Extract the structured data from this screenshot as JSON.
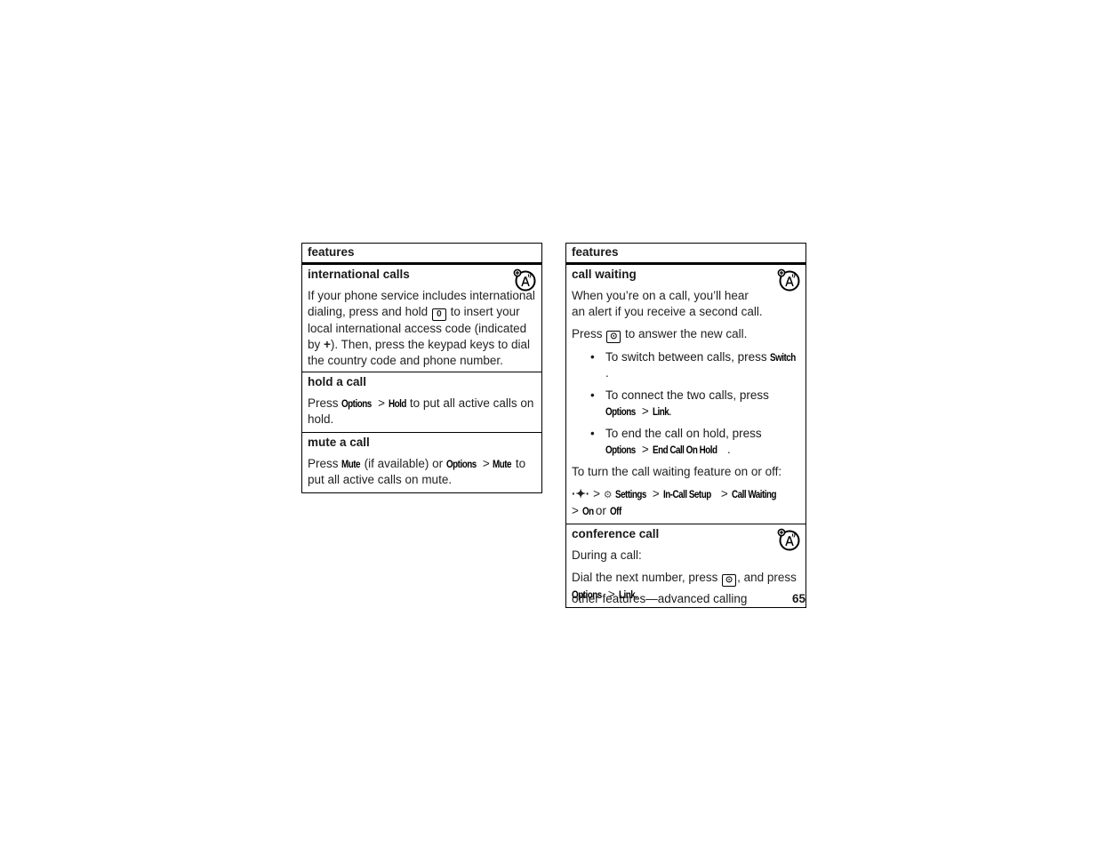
{
  "left_table": {
    "header": "features",
    "rows": [
      {
        "title": "international calls",
        "icon": "network-feature-icon",
        "text": [
          "If your phone service includes international dialing, press and hold ",
          "0",
          " to insert your local international access code (indicated by ",
          "+",
          "). Then, press the keypad keys to dial the country code and phone number."
        ]
      },
      {
        "title": "hold a call",
        "text": [
          "Press ",
          "Options",
          " > ",
          "Hold",
          " to put all active calls on hold."
        ]
      },
      {
        "title": "mute a call",
        "text": [
          "Press ",
          "Mute",
          " (if available) or ",
          "Options",
          " > ",
          "Mute",
          " to put all active calls on mute."
        ]
      }
    ]
  },
  "right_table": {
    "header": "features",
    "rows": [
      {
        "title": "call waiting",
        "icon": "network-feature-icon",
        "p1": "When you’re on a call, you’ll hear an alert if you receive a second call.",
        "p2": [
          "Press ",
          "send-key",
          " to answer the new call."
        ],
        "bullets": [
          [
            "To switch between calls, press ",
            "Switch",
            "."
          ],
          [
            "To connect the two calls, press ",
            "Options",
            " > ",
            "Link",
            "."
          ],
          [
            "To end the call on hold, press ",
            "Options",
            " > ",
            "End Call On Hold",
            "."
          ]
        ],
        "p3": "To turn the call waiting feature on or off:",
        "path": [
          "nav-key",
          " > ",
          "settings-icon",
          "Settings",
          " > ",
          "In-Call Setup",
          " > ",
          "Call Waiting",
          " > ",
          "On",
          " or ",
          "Off"
        ]
      },
      {
        "title": "conference call",
        "icon": "network-feature-icon",
        "p1": "During a call:",
        "p2": [
          "Dial the next number, press ",
          "send-key",
          ", and press ",
          "Options",
          " > ",
          "Link",
          "."
        ]
      }
    ]
  },
  "footer": {
    "section": "other features—advanced calling",
    "page": "65"
  }
}
